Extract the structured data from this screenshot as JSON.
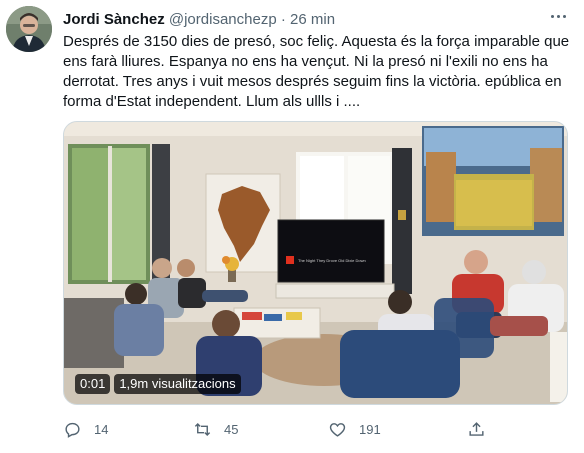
{
  "tweet": {
    "author_name": "Jordi Sànchez",
    "handle": "@jordisanchezp",
    "separator": "·",
    "time": "26 min",
    "text_lines": [
      "Després de 3150 dies de presó, soc feliç. Aquesta és la força imparable que",
      "ens farà lliures. Espanya no ens ha vençut. Ni la presó ni l'exili  no ens ha",
      "derrotat. Tres anys i vuit mesos després seguim fins la victòria. epública en",
      "forma d'Estat independent. Llum als ullls i ...."
    ]
  },
  "video": {
    "elapsed": "0:01",
    "views": "1,9m visualitzacions",
    "tv_caption": "The Night They Drove Old Dixie Down"
  },
  "actions": {
    "reply_count": "14",
    "retweet_count": "45",
    "like_count": "191",
    "share_count": ""
  },
  "icons": {
    "more": "more-icon",
    "reply": "reply-icon",
    "retweet": "retweet-icon",
    "like": "heart-icon",
    "share": "share-icon"
  },
  "colors": {
    "text_primary": "#0f1419",
    "text_secondary": "#536471",
    "tv_logo": "#e0301e"
  }
}
